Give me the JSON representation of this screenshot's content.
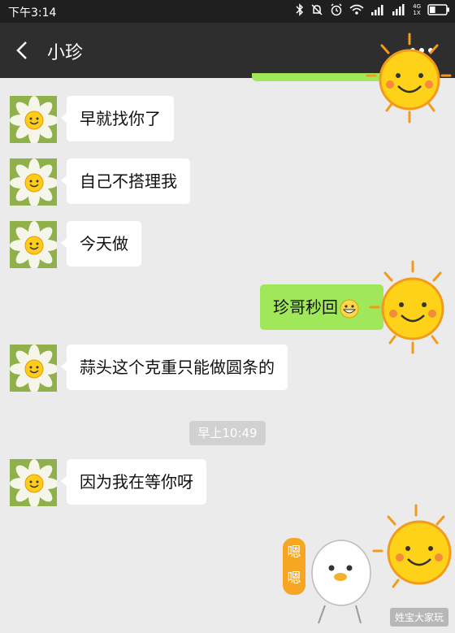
{
  "status_bar": {
    "time": "下午3:14",
    "network_top": "4G",
    "network_bottom": "1X",
    "battery_level": 0.35
  },
  "header": {
    "title": "小珍"
  },
  "messages": [
    {
      "side": "left",
      "text": "早就找你了"
    },
    {
      "side": "left",
      "text": "自己不搭理我"
    },
    {
      "side": "left",
      "text": "今天做"
    },
    {
      "side": "right",
      "text": "珍哥秒回"
    },
    {
      "side": "left",
      "text": "蒜头这个克重只能做圆条的"
    },
    {
      "side": "left",
      "text": "因为我在等你呀"
    }
  ],
  "timestamp": "早上10:49",
  "sticker": {
    "text": "嗯嗯"
  },
  "watermark": "姓宝大家玩",
  "colors": {
    "my_bubble": "#a0e759",
    "their_bubble": "#ffffff",
    "background": "#ebebeb",
    "titlebar": "#2e2e2e"
  }
}
